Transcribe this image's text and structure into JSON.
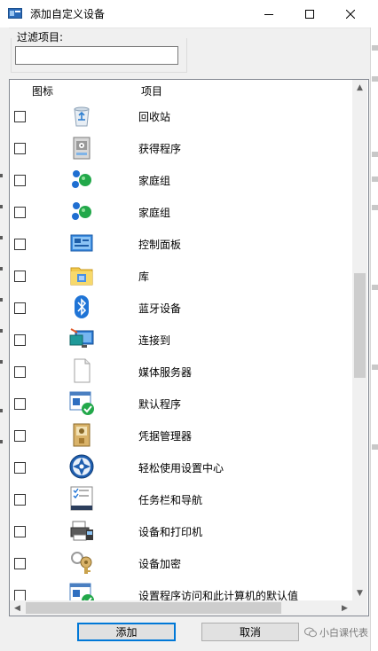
{
  "window": {
    "title": "添加自定义设备",
    "controls": {
      "minimize": "minimize",
      "maximize": "maximize",
      "close": "close"
    }
  },
  "filter": {
    "label": "过滤项目:",
    "value": "",
    "placeholder": ""
  },
  "list": {
    "columns": {
      "icon": "图标",
      "item": "项目"
    },
    "items": [
      {
        "label": "回收站",
        "icon": "recycle-bin-icon",
        "checked": false
      },
      {
        "label": "获得程序",
        "icon": "get-programs-icon",
        "checked": false
      },
      {
        "label": "家庭组",
        "icon": "homegroup-icon",
        "checked": false
      },
      {
        "label": "家庭组",
        "icon": "homegroup-icon",
        "checked": false
      },
      {
        "label": "控制面板",
        "icon": "control-panel-icon",
        "checked": false
      },
      {
        "label": "库",
        "icon": "library-icon",
        "checked": false
      },
      {
        "label": "蓝牙设备",
        "icon": "bluetooth-icon",
        "checked": false
      },
      {
        "label": "连接到",
        "icon": "connect-to-icon",
        "checked": false
      },
      {
        "label": "媒体服务器",
        "icon": "media-server-icon",
        "checked": false
      },
      {
        "label": "默认程序",
        "icon": "default-programs-icon",
        "checked": false
      },
      {
        "label": "凭据管理器",
        "icon": "credential-manager-icon",
        "checked": false
      },
      {
        "label": "轻松使用设置中心",
        "icon": "ease-of-access-icon",
        "checked": false
      },
      {
        "label": "任务栏和导航",
        "icon": "taskbar-navigation-icon",
        "checked": false
      },
      {
        "label": "设备和打印机",
        "icon": "devices-printers-icon",
        "checked": false
      },
      {
        "label": "设备加密",
        "icon": "device-encryption-icon",
        "checked": false
      },
      {
        "label": "设置程序访问和此计算机的默认值",
        "icon": "program-access-defaults-icon",
        "checked": false
      }
    ]
  },
  "buttons": {
    "add": "添加",
    "cancel": "取消"
  },
  "watermark": {
    "text": "小白课代表"
  },
  "colors": {
    "accent": "#0078d7",
    "window_bg": "#f0f0f0",
    "list_bg": "#ffffff"
  }
}
